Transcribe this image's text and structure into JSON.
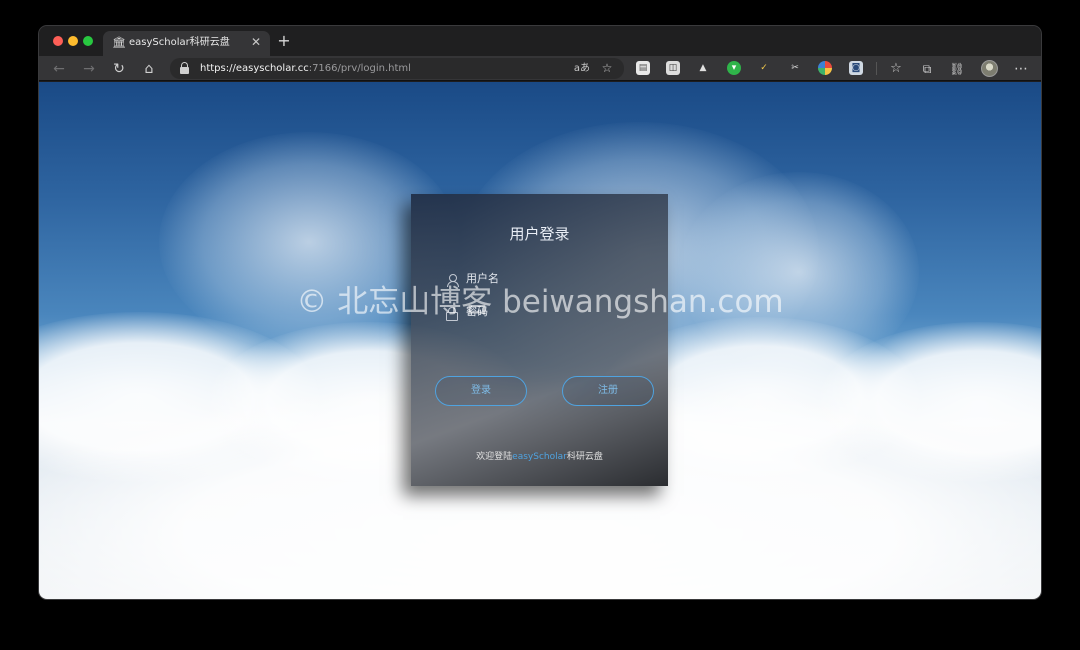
{
  "browser": {
    "tab": {
      "title": "easyScholar科研云盘",
      "icon": "bank-icon"
    },
    "url": {
      "host": "https://easyscholar.cc",
      "rest": ":7166/prv/login.html"
    },
    "toolbar_icons": [
      "back-icon",
      "forward-icon",
      "reload-icon",
      "home-icon",
      "translate-icon",
      "favorite-add-icon",
      "reading-mode-icon",
      "collections-icon",
      "extensions-icon",
      "profile-avatar",
      "more-icon"
    ]
  },
  "login": {
    "title": "用户登录",
    "username_label": "用户名",
    "password_label": "密码",
    "login_button": "登录",
    "register_button": "注册",
    "footer_prefix": "欢迎登陆",
    "footer_brand": "easyScholar",
    "footer_suffix": "科研云盘"
  },
  "watermark": "© 北忘山博客 beiwangshan.com",
  "colors": {
    "accent": "#4fa3e0",
    "sky_top": "#1a4a86",
    "cloud": "#ffffff"
  }
}
